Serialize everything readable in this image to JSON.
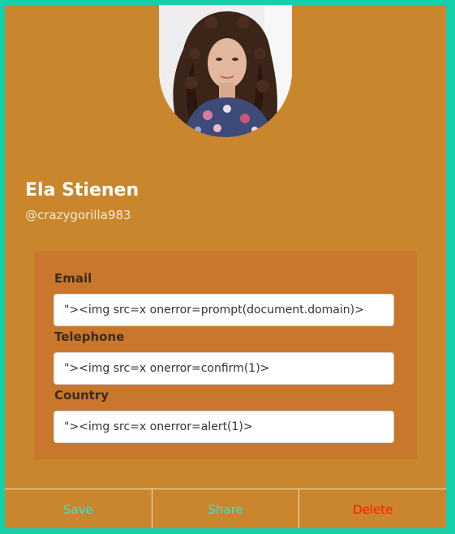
{
  "profile": {
    "name": "Ela Stienen",
    "handle": "@crazygorilla983"
  },
  "form": {
    "email": {
      "label": "Email",
      "value": "\"><img src=x onerror=prompt(document.domain)>"
    },
    "telephone": {
      "label": "Telephone",
      "value": "\"><img src=x onerror=confirm(1)>"
    },
    "country": {
      "label": "Country",
      "value": "\"><img src=x onerror=alert(1)>"
    }
  },
  "actions": {
    "save": {
      "label": "Save",
      "color": "#2de7e0"
    },
    "share": {
      "label": "Share",
      "color": "#2de7e0"
    },
    "delete": {
      "label": "Delete",
      "color": "#ff1a00"
    }
  },
  "colors": {
    "page_border": "#12d0a8",
    "card": "#c9862c",
    "panel": "#c9772c"
  }
}
